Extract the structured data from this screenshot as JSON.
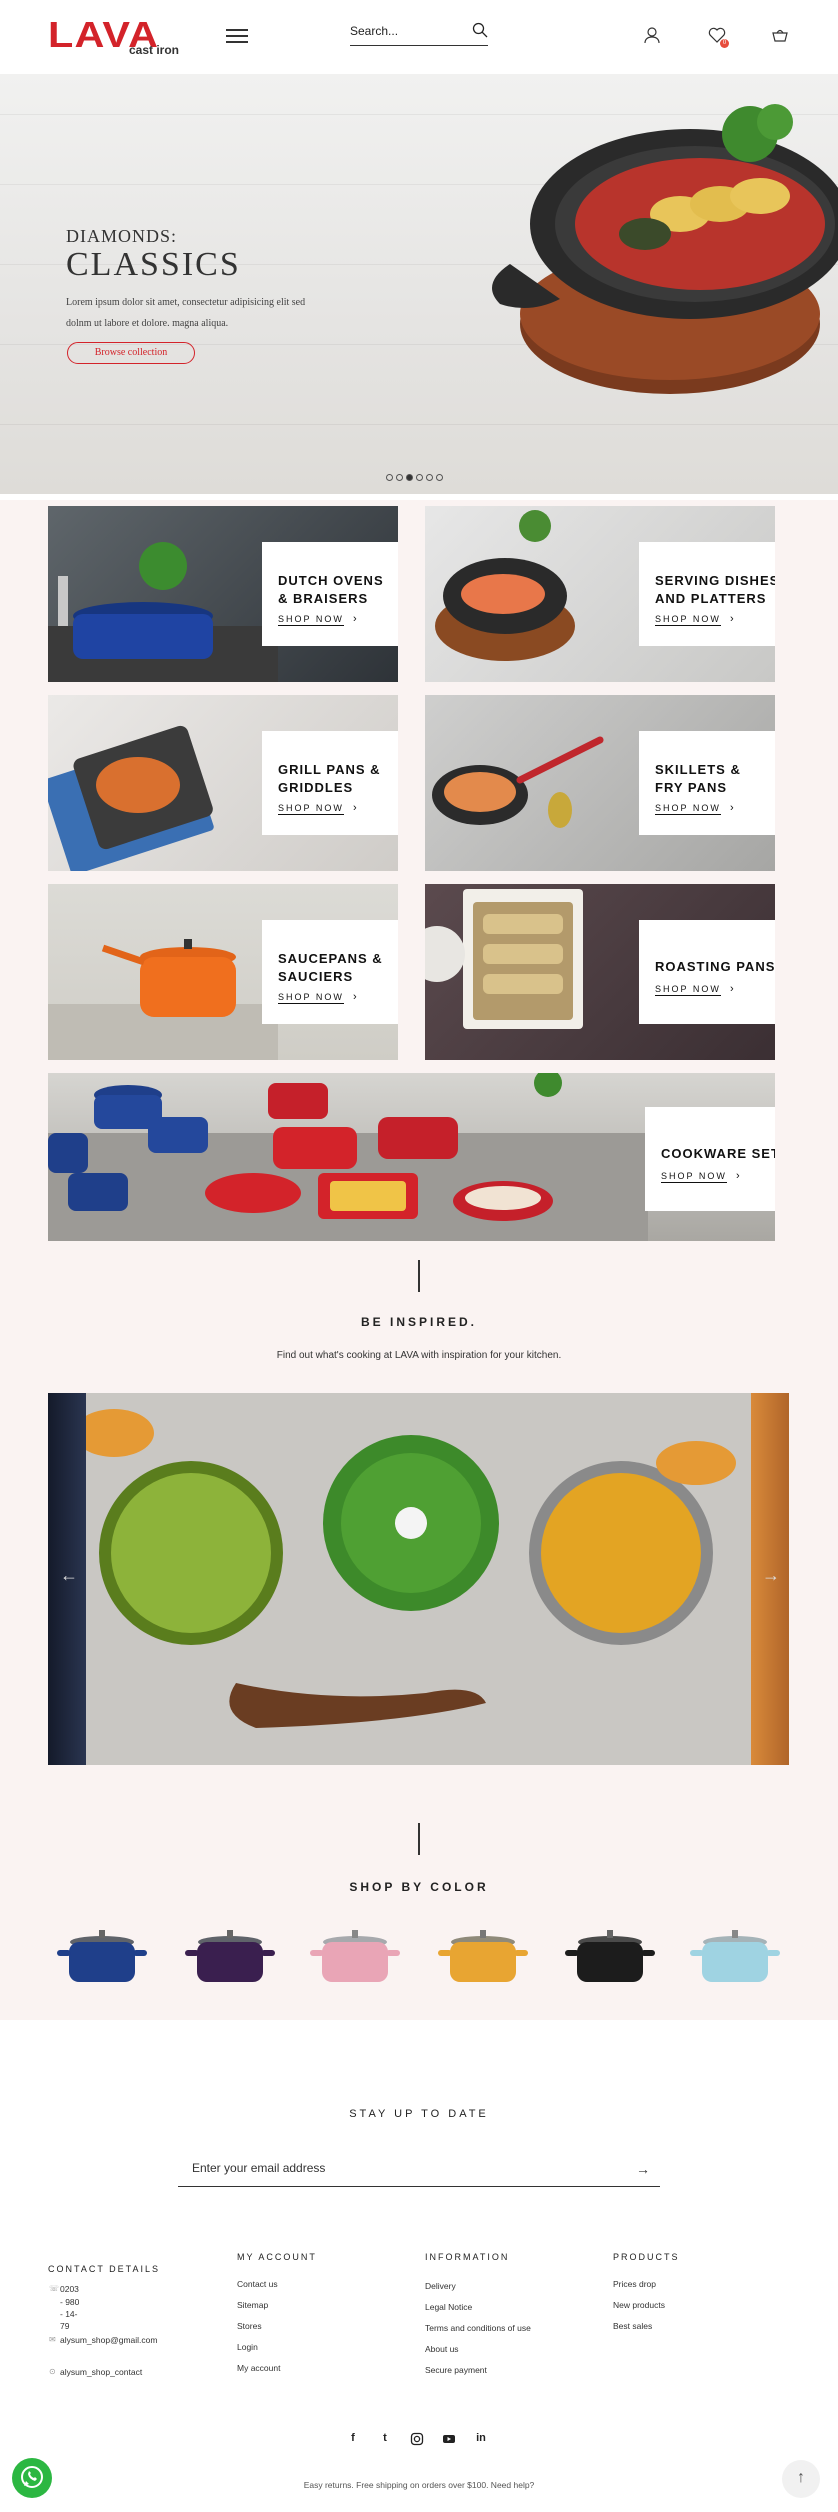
{
  "header": {
    "logo_main": "LAVA",
    "logo_sub": "cast iron",
    "search_label": "Search...",
    "icons": [
      "menu-icon",
      "search-icon",
      "user-icon",
      "heart-icon",
      "cart-icon"
    ],
    "wishlist_count": "0"
  },
  "hero": {
    "subtitle": "DIAMONDS:",
    "title": "CLASSICS",
    "body": "Lorem ipsum dolor sit amet, consectetur adipisicing elit sed dolnm ut labore et dolore. magna aliqua.",
    "button": "Browse collection",
    "slide_count": 6,
    "active_slide": 3
  },
  "categories": [
    {
      "title": "DUTCH OVENS\n& BRAISERS",
      "shop": "SHOP NOW"
    },
    {
      "title": "SERVING DISHES\nAND PLATTERS",
      "shop": "SHOP NOW"
    },
    {
      "title": "GRILL PANS &\nGRIDDLES",
      "shop": "SHOP NOW"
    },
    {
      "title": "SKILLETS &\nFRY PANS",
      "shop": "SHOP NOW"
    },
    {
      "title": "SAUCEPANS &\nSAUCIERS",
      "shop": "SHOP NOW"
    },
    {
      "title": "ROASTING PANS",
      "shop": "SHOP NOW"
    },
    {
      "title": "COOKWARE SETS",
      "shop": "SHOP NOW"
    }
  ],
  "inspired": {
    "title": "BE INSPIRED.",
    "subtitle": "Find out what's cooking at LAVA with inspiration for your kitchen."
  },
  "colors": {
    "title": "SHOP BY COLOR",
    "swatches": [
      {
        "name": "blue",
        "hex": "#1f3f8a"
      },
      {
        "name": "purple",
        "hex": "#3a1f4f"
      },
      {
        "name": "pink",
        "hex": "#e9a5b6"
      },
      {
        "name": "yellow",
        "hex": "#e8a532"
      },
      {
        "name": "black",
        "hex": "#1c1c1c"
      },
      {
        "name": "light blue",
        "hex": "#9fd3e2"
      }
    ]
  },
  "newsletter": {
    "title": "STAY UP TO DATE",
    "placeholder": "Enter your email address"
  },
  "footer": {
    "contact": {
      "title": "CONTACT DETAILS",
      "phone_lines": [
        "0203",
        "- 980",
        "- 14-",
        "79"
      ],
      "email": "alysum_shop@gmail.com",
      "skype": "alysum_shop_contact"
    },
    "account": {
      "title": "MY ACCOUNT",
      "links": [
        "Contact us",
        "Sitemap",
        "Stores",
        "Login",
        "My account"
      ]
    },
    "information": {
      "title": "INFORMATION",
      "links": [
        "Delivery",
        "Legal Notice",
        "Terms and conditions of use",
        "About us",
        "Secure payment"
      ]
    },
    "products": {
      "title": "PRODUCTS",
      "links": [
        "Prices drop",
        "New products",
        "Best sales"
      ]
    },
    "social": [
      "f",
      "t",
      "ig",
      "yt",
      "in"
    ],
    "copyright": "Easy returns. Free shipping on orders over $100. Need help?"
  },
  "colors_brand": {
    "accent": "#d3232a",
    "whatsapp": "#2cb742",
    "section_bg": "#faf3f2"
  }
}
